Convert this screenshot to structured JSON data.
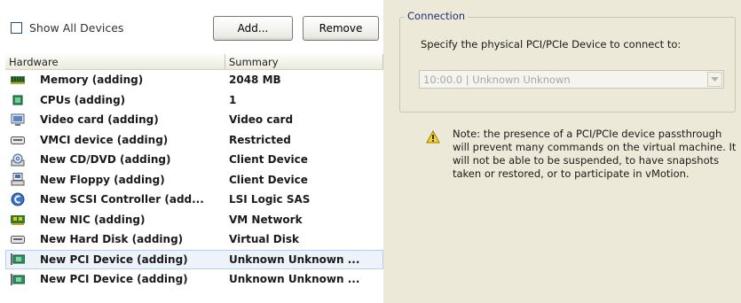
{
  "toolbar": {
    "show_all_label": "Show All Devices",
    "show_all_checked": false,
    "add_label": "Add...",
    "remove_label": "Remove"
  },
  "table": {
    "columns": [
      "Hardware",
      "Summary"
    ],
    "rows": [
      {
        "icon": "memory-icon",
        "hardware": "Memory (adding)",
        "summary": "2048 MB",
        "selected": false
      },
      {
        "icon": "cpu-icon",
        "hardware": "CPUs (adding)",
        "summary": "1",
        "selected": false
      },
      {
        "icon": "monitor-icon",
        "hardware": "Video card  (adding)",
        "summary": "Video card",
        "selected": false
      },
      {
        "icon": "vmci-device-icon",
        "hardware": "VMCI device (adding)",
        "summary": "Restricted",
        "selected": false
      },
      {
        "icon": "cd-dvd-drive-icon",
        "hardware": "New CD/DVD (adding)",
        "summary": "Client Device",
        "selected": false
      },
      {
        "icon": "floppy-drive-icon",
        "hardware": "New Floppy (adding)",
        "summary": "Client Device",
        "selected": false
      },
      {
        "icon": "scsi-controller-icon",
        "hardware": "New SCSI Controller (add...",
        "summary": "LSI Logic SAS",
        "selected": false
      },
      {
        "icon": "network-card-icon",
        "hardware": "New NIC (adding)",
        "summary": "VM Network",
        "selected": false
      },
      {
        "icon": "hard-disk-icon",
        "hardware": "New Hard Disk (adding)",
        "summary": "Virtual Disk",
        "selected": false
      },
      {
        "icon": "pci-device-icon",
        "hardware": "New PCI Device (adding)",
        "summary": "Unknown Unknown ...",
        "selected": true
      },
      {
        "icon": "pci-device-icon",
        "hardware": "New PCI Device (adding)",
        "summary": "Unknown Unknown ...",
        "selected": false
      }
    ]
  },
  "connection": {
    "legend": "Connection",
    "instruction": "Specify the physical PCI/PCIe Device to connect to:",
    "device_select_value": "10:00.0 | Unknown Unknown"
  },
  "note": {
    "icon": "warning-icon",
    "text": "Note: the presence of a PCI/PCIe device passthrough will prevent many commands on the virtual machine. It will not be able to be suspended, to have snapshots taken or restored, or to participate in vMotion."
  },
  "colors": {
    "selected_row": "#edf3fb",
    "panel_background": "#ece9d8",
    "legend_text": "#1d2f75"
  }
}
